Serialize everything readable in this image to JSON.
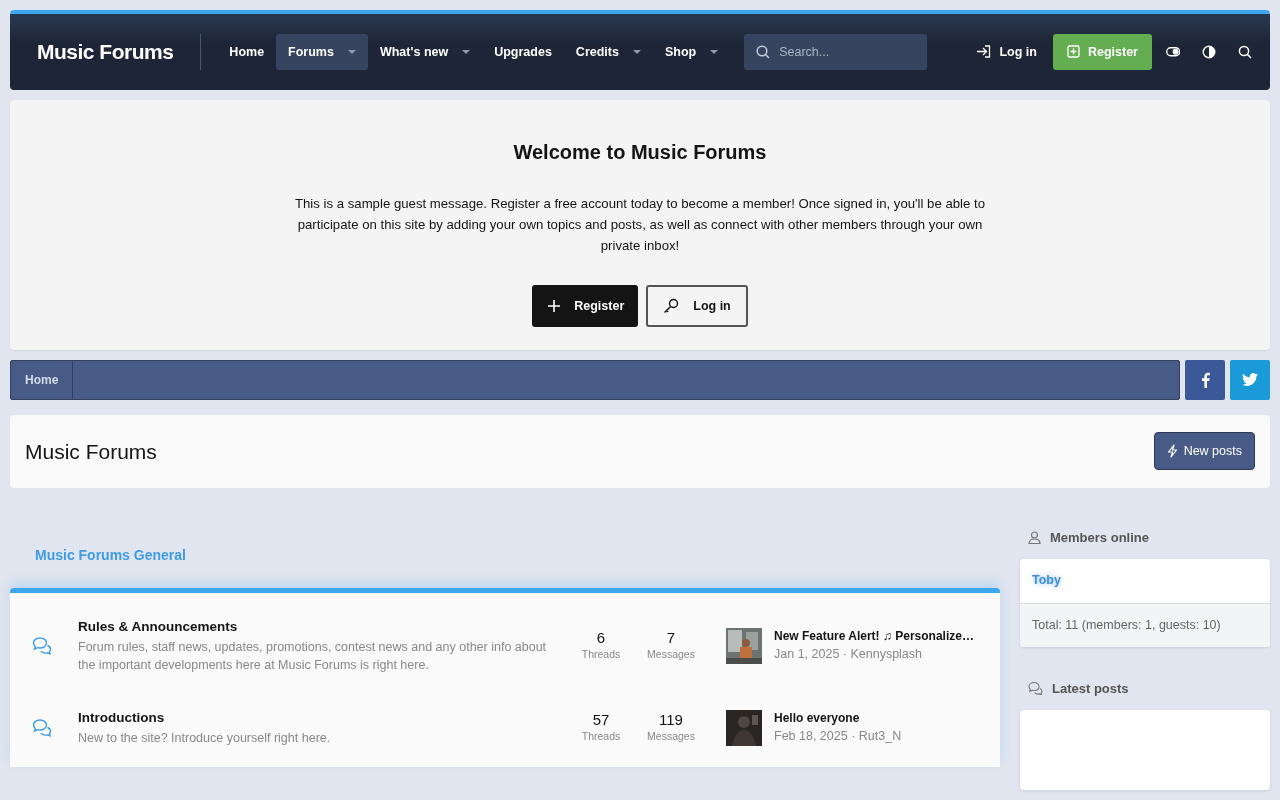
{
  "header": {
    "logo": "Music Forums",
    "nav": [
      {
        "label": "Home",
        "selected": false,
        "dropdown": false
      },
      {
        "label": "Forums",
        "selected": true,
        "dropdown": true
      },
      {
        "label": "What's new",
        "selected": false,
        "dropdown": true
      },
      {
        "label": "Upgrades",
        "selected": false,
        "dropdown": false
      },
      {
        "label": "Credits",
        "selected": false,
        "dropdown": true
      },
      {
        "label": "Shop",
        "selected": false,
        "dropdown": true
      }
    ],
    "search": {
      "placeholder": "Search..."
    },
    "login": "Log in",
    "register": "Register"
  },
  "notice": {
    "title": "Welcome to Music Forums",
    "message": "This is a sample guest message. Register a free account today to become a member! Once signed in, you'll be able to participate on this site by adding your own topics and posts, as well as connect with other members through your own private inbox!",
    "buttons": [
      {
        "label": "Register",
        "kind": "primary"
      },
      {
        "label": "Log in",
        "kind": "outline"
      }
    ]
  },
  "breadcrumb": [
    "Home"
  ],
  "page": {
    "title": "Music Forums",
    "action": "New posts"
  },
  "category": {
    "title": "Music Forums General",
    "nodes": [
      {
        "title": "Rules & Announcements",
        "description": "Forum rules, staff news, updates, promotions, contest news and any other info about the important developments here at Music Forums is right here.",
        "threads": "6",
        "threads_label": "Threads",
        "messages": "7",
        "messages_label": "Messages",
        "latest": {
          "title": "New Feature Alert! ♫ Personalize…",
          "meta": "Jan 1, 2025 · Kennysplash"
        }
      },
      {
        "title": "Introductions",
        "description": "New to the site? Introduce yourself right here.",
        "threads": "57",
        "threads_label": "Threads",
        "messages": "119",
        "messages_label": "Messages",
        "latest": {
          "title": "Hello everyone",
          "meta": "Feb 18, 2025 · Rut3_N"
        }
      }
    ]
  },
  "sidebar": {
    "members_online": {
      "title": "Members online",
      "members": [
        "Toby"
      ],
      "total": "Total: 11 (members: 1, guests: 10)"
    },
    "latest_posts": {
      "title": "Latest posts"
    }
  }
}
